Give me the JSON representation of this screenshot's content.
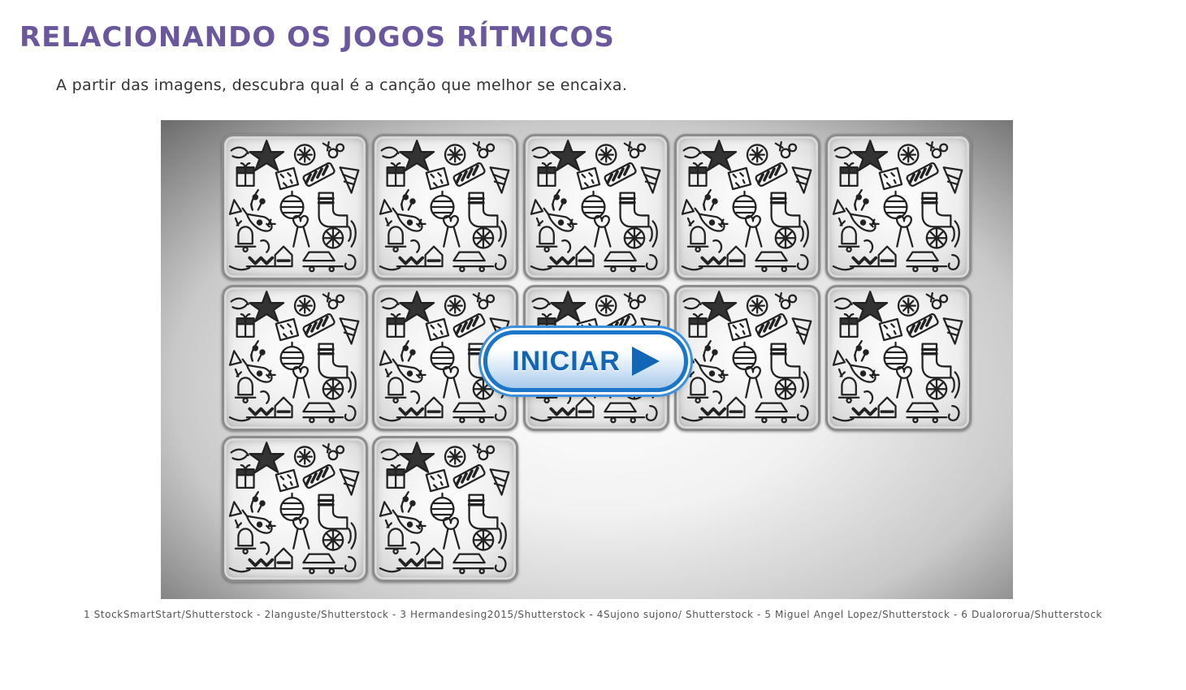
{
  "page": {
    "title": "RELACIONANDO OS JOGOS RÍTMICOS",
    "instruction": "A partir das imagens, descubra qual é a canção que melhor se encaixa."
  },
  "game": {
    "start_button_label": "INICIAR",
    "card_count": 12,
    "card_face": "christmas-doodle-pattern"
  },
  "credits": "1 StockSmartStart/Shutterstock - 2languste/Shutterstock - 3 Hermandesing2015/Shutterstock - 4Sujono sujono/ Shutterstock - 5 Miguel Angel Lopez/Shutterstock - 6 Dualororua/Shutterstock",
  "colors": {
    "title": "#6b579d",
    "button_accent": "#1266b5"
  }
}
